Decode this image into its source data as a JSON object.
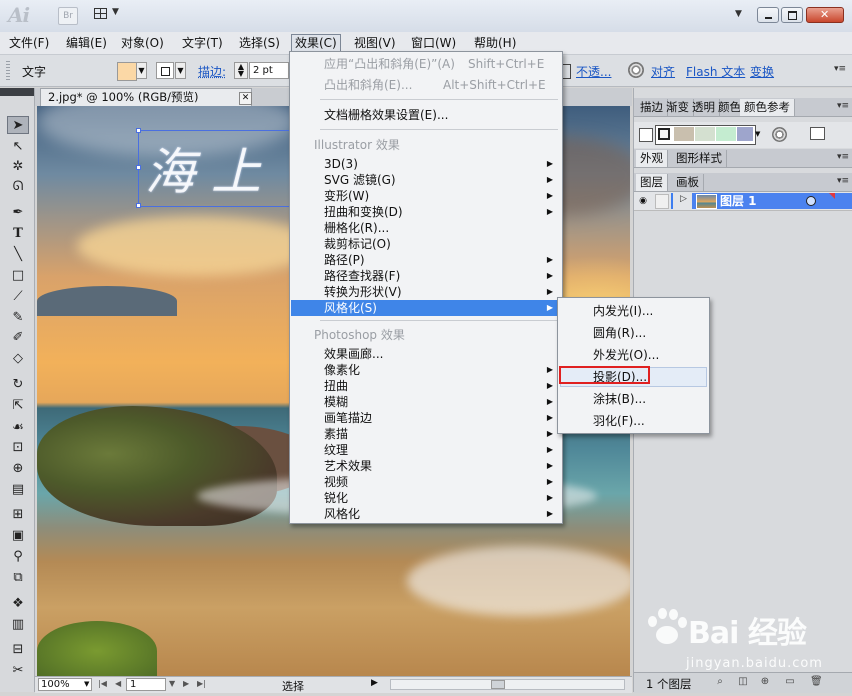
{
  "title_bar": {
    "app_logo": "Ai",
    "bridge_button": "Br",
    "window_controls": [
      "minimize",
      "maximize",
      "close"
    ]
  },
  "menu_bar": {
    "items": [
      "文件(F)",
      "编辑(E)",
      "对象(O)",
      "文字(T)",
      "选择(S)",
      "效果(C)",
      "视图(V)",
      "窗口(W)",
      "帮助(H)"
    ],
    "active_index": 5
  },
  "control_bar": {
    "mode_label": "文字",
    "fill_color": "#fbd8a6",
    "stroke_label": "描边:",
    "stroke_weight": "2 pt",
    "transparency_link": "不透...",
    "align_link": "对齐",
    "flash_text_link": "Flash 文本",
    "transform_link": "变换"
  },
  "document": {
    "tab_title": "2.jpg* @ 100% (RGB/预览)",
    "canvas_text": "海上"
  },
  "effect_menu": {
    "top_items": [
      {
        "label": "应用“凸出和斜角(E)”(A)",
        "shortcut": "Shift+Ctrl+E",
        "disabled": true
      },
      {
        "label": "凸出和斜角(E)...",
        "shortcut": "Alt+Shift+Ctrl+E",
        "disabled": true
      }
    ],
    "doc_raster_settings": "文档栅格效果设置(E)...",
    "illustrator_header": "Illustrator 效果",
    "illustrator_items": [
      {
        "label": "3D(3)",
        "submenu": true
      },
      {
        "label": "SVG 滤镜(G)",
        "submenu": true
      },
      {
        "label": "变形(W)",
        "submenu": true
      },
      {
        "label": "扭曲和变换(D)",
        "submenu": true
      },
      {
        "label": "栅格化(R)...",
        "submenu": false
      },
      {
        "label": "裁剪标记(O)",
        "submenu": false
      },
      {
        "label": "路径(P)",
        "submenu": true
      },
      {
        "label": "路径查找器(F)",
        "submenu": true
      },
      {
        "label": "转换为形状(V)",
        "submenu": true
      },
      {
        "label": "风格化(S)",
        "submenu": true,
        "highlighted": true
      }
    ],
    "photoshop_header": "Photoshop 效果",
    "photoshop_items": [
      {
        "label": "效果画廊...",
        "submenu": false
      },
      {
        "label": "像素化",
        "submenu": true
      },
      {
        "label": "扭曲",
        "submenu": true
      },
      {
        "label": "模糊",
        "submenu": true
      },
      {
        "label": "画笔描边",
        "submenu": true
      },
      {
        "label": "素描",
        "submenu": true
      },
      {
        "label": "纹理",
        "submenu": true
      },
      {
        "label": "艺术效果",
        "submenu": true
      },
      {
        "label": "视频",
        "submenu": true
      },
      {
        "label": "锐化",
        "submenu": true
      },
      {
        "label": "风格化",
        "submenu": true
      }
    ]
  },
  "stylize_submenu": {
    "items": [
      "内发光(I)...",
      "圆角(R)...",
      "外发光(O)...",
      "投影(D)...",
      "涂抹(B)...",
      "羽化(F)..."
    ],
    "hover_index": 3,
    "annotated_index": 3,
    "annotation_color": "#e02020"
  },
  "right_panels": {
    "top_tabs": [
      "描边",
      "渐变",
      "透明",
      "颜色",
      "颜色参考"
    ],
    "mid_tabs": [
      "外观",
      "图形样式"
    ],
    "layer_tabs": [
      "图层",
      "画板"
    ],
    "guide_colors": [
      "#f4f4f4",
      "#c9bfae",
      "#d4e0d0",
      "#c4ecd0",
      "#9ea5cc"
    ],
    "layer_name": "图层 1",
    "layer_count": "1 个图层"
  },
  "status_bar": {
    "zoom": "100%",
    "page": "1",
    "status_label": "选择"
  },
  "watermark": {
    "brand": "Bai 经验",
    "sub": "jingyan.baidu.com"
  }
}
